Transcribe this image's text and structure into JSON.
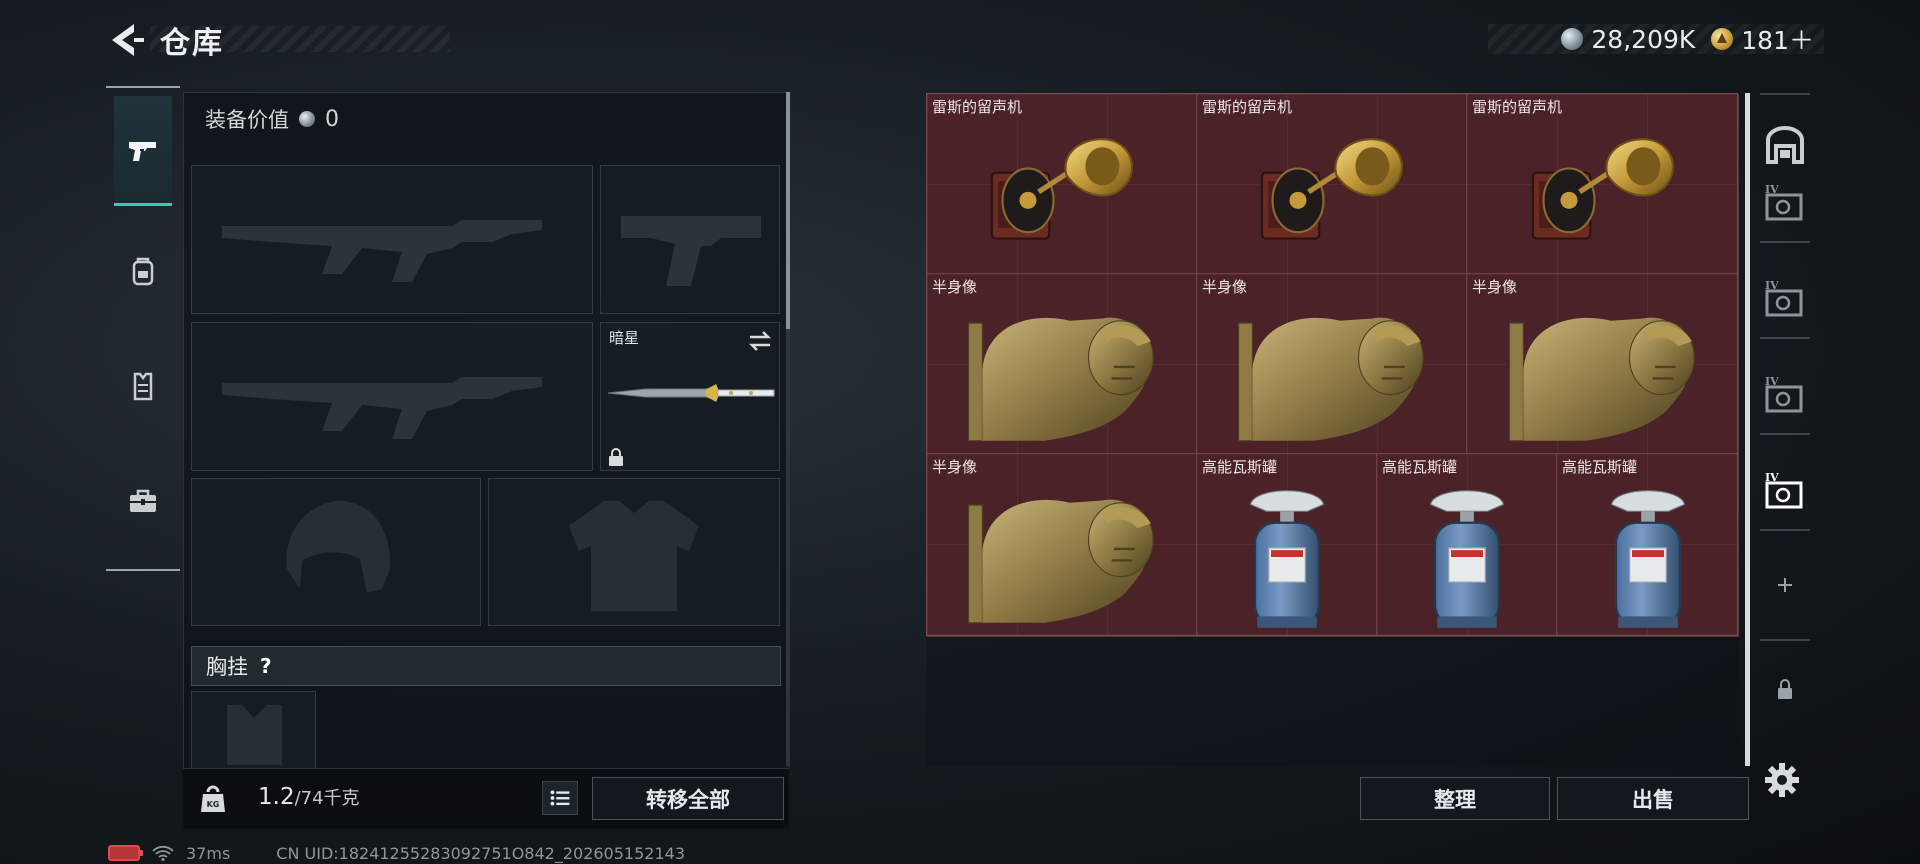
{
  "header": {
    "title": "仓库",
    "currency": [
      {
        "icon": "silver-coin-icon",
        "value": "28,209K"
      },
      {
        "icon": "gold-triangle-coin-icon",
        "value": "181＋"
      }
    ]
  },
  "sidebar": {
    "tabs": [
      {
        "name": "pistol-icon",
        "active": true
      },
      {
        "name": "backpack-icon",
        "active": false
      },
      {
        "name": "vest-icon",
        "active": false
      },
      {
        "name": "toolbox-icon",
        "active": false
      }
    ]
  },
  "equipment": {
    "value_label": "装备价值",
    "value": "0",
    "melee_name": "暗星",
    "chest_rig_label": "胸挂",
    "chest_rig_help": "?"
  },
  "weight": {
    "current": "1.2",
    "max": "/74千克"
  },
  "buttons": {
    "transfer_all": "转移全部",
    "sort": "整理",
    "sell": "出售"
  },
  "storage_items": [
    {
      "name": "雷斯的留声机",
      "type": "gramophone"
    },
    {
      "name": "雷斯的留声机",
      "type": "gramophone"
    },
    {
      "name": "雷斯的留声机",
      "type": "gramophone"
    },
    {
      "name": "半身像",
      "type": "bust"
    },
    {
      "name": "半身像",
      "type": "bust"
    },
    {
      "name": "半身像",
      "type": "bust"
    },
    {
      "name": "半身像",
      "type": "bust"
    },
    {
      "name": "高能瓦斯罐",
      "type": "gas-canister"
    },
    {
      "name": "高能瓦斯罐",
      "type": "gas-canister"
    },
    {
      "name": "高能瓦斯罐",
      "type": "gas-canister"
    }
  ],
  "storage_tabs": [
    "IV",
    "IV",
    "IV",
    "IV"
  ],
  "status": {
    "ping": "37ms",
    "uid": "CN UID:18241255283092751O842_202605152143"
  },
  "colors": {
    "accent": "#39c9b6",
    "grid_bg": "#4a2227"
  }
}
